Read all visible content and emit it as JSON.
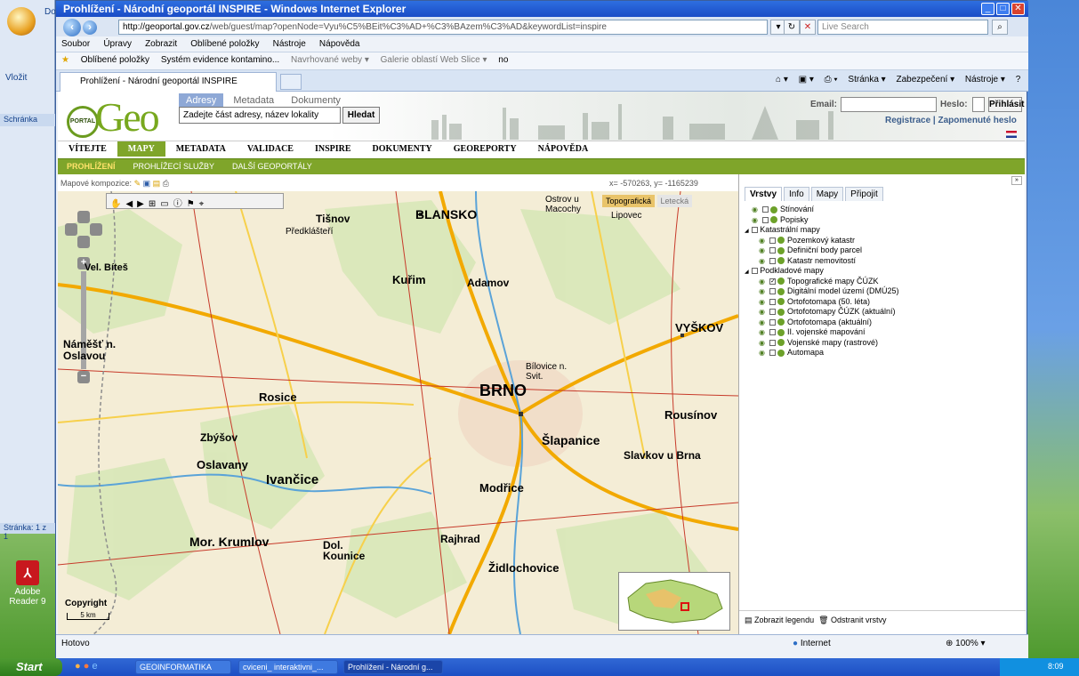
{
  "window": {
    "title": "Prohlížení - Národní geoportál INSPIRE - Windows Internet Explorer"
  },
  "word": {
    "tab": "Dom",
    "paste": "Vložit",
    "clipboard": "Schránka",
    "page": "Stránka: 1 z 1"
  },
  "desktop": {
    "icon_label": "Adobe Reader 9"
  },
  "browser": {
    "address_host": "http://geoportal.gov.cz",
    "address_path": "/web/guest/map?openNode=Vyu%C5%BEit%C3%AD+%C3%BAzem%C3%AD&keywordList=inspire",
    "live_search": "Live Search",
    "menu": [
      "Soubor",
      "Úpravy",
      "Zobrazit",
      "Oblíbené položky",
      "Nástroje",
      "Nápověda"
    ],
    "favorites": [
      {
        "label": "Oblíbené položky",
        "dim": false
      },
      {
        "label": "Systém evidence kontamino...",
        "dim": false
      },
      {
        "label": "Navrhované weby ▾",
        "dim": true
      },
      {
        "label": "Galerie oblastí Web Slice ▾",
        "dim": true
      },
      {
        "label": "no",
        "dim": false
      }
    ],
    "tab_title": "Prohlížení - Národní geoportál INSPIRE",
    "commands": [
      "Stránka ▾",
      "Zabezpečení ▾",
      "Nástroje ▾"
    ],
    "status": "Hotovo",
    "zone": "Internet",
    "zoom": "100%"
  },
  "page": {
    "logo_small": "PORTAL",
    "logo_big": "Geo",
    "search_tabs": [
      "Adresy",
      "Metadata",
      "Dokumenty"
    ],
    "search_placeholder": "Zadejte část adresy, název lokality",
    "search_button": "Hledat",
    "email_label": "Email:",
    "password_label": "Heslo:",
    "login_button": "Přihlásit",
    "register": "Registrace",
    "forgot": "Zapomenuté heslo",
    "nav": [
      "VÍTEJTE",
      "MAPY",
      "METADATA",
      "VALIDACE",
      "INSPIRE",
      "DOKUMENTY",
      "GEOREPORTY",
      "NÁPOVĚDA"
    ],
    "nav_active": "MAPY",
    "subnav": [
      "PROHLÍŽENÍ",
      "PROHLÍŽECÍ SLUŽBY",
      "DALŠÍ GEOPORTÁLY"
    ],
    "subnav_active": "PROHLÍŽENÍ",
    "compositions_label": "Mapové kompozice:",
    "coords": "x= -570263, y= -1165239"
  },
  "map": {
    "basemap_tabs": [
      "Topografická",
      "Letecká"
    ],
    "copyright": "Copyright",
    "scale": "5 km",
    "places": [
      {
        "t": "BLANSKO",
        "b": true
      },
      {
        "t": "BRNO",
        "b": true
      },
      {
        "t": "VYŠKOV",
        "b": true
      },
      {
        "t": "Tišnov",
        "b": false
      },
      {
        "t": "Kuřim",
        "b": false
      },
      {
        "t": "Rosice",
        "b": false
      },
      {
        "t": "Ivančice",
        "b": false
      },
      {
        "t": "Šlapanice",
        "b": false
      },
      {
        "t": "Slavkov u Brna",
        "b": false
      },
      {
        "t": "Židlochovice",
        "b": false
      },
      {
        "t": "Modřice",
        "b": false
      },
      {
        "t": "Rousínov",
        "b": false
      },
      {
        "t": "Mor. Krumlov",
        "b": false
      },
      {
        "t": "Náměšť n. Oslavou",
        "b": false
      },
      {
        "t": "Vel. Bíteš",
        "b": false
      },
      {
        "t": "Adamov",
        "b": false
      },
      {
        "t": "Oslavany",
        "b": false
      },
      {
        "t": "Zbýšov",
        "b": false
      },
      {
        "t": "Dol. Kounice",
        "b": false
      },
      {
        "t": "Rajhrad",
        "b": false
      },
      {
        "t": "Předklášteří",
        "b": false
      },
      {
        "t": "Lipovec",
        "b": false
      },
      {
        "t": "Bílovice n. Svit.",
        "b": false
      },
      {
        "t": "Ostrov u Macochy",
        "b": false
      }
    ]
  },
  "layers_panel": {
    "tabs": [
      "Vrstvy",
      "Info",
      "Mapy",
      "Připojit"
    ],
    "active_tab": "Vrstvy",
    "items": [
      {
        "label": "Stínování",
        "group": false,
        "indent": 1,
        "checked": false
      },
      {
        "label": "Popisky",
        "group": false,
        "indent": 1,
        "checked": false
      },
      {
        "label": "Katastrální mapy",
        "group": true,
        "indent": 0,
        "checked": false
      },
      {
        "label": "Pozemkový katastr",
        "group": false,
        "indent": 2,
        "checked": false
      },
      {
        "label": "Definiční body parcel",
        "group": false,
        "indent": 2,
        "checked": false
      },
      {
        "label": "Katastr nemovitostí",
        "group": false,
        "indent": 2,
        "checked": false
      },
      {
        "label": "Podkladové mapy",
        "group": true,
        "indent": 0,
        "checked": false
      },
      {
        "label": "Topografické mapy ČÚZK",
        "group": false,
        "indent": 2,
        "checked": true
      },
      {
        "label": "Digitální model území (DMÚ25)",
        "group": false,
        "indent": 2,
        "checked": false
      },
      {
        "label": "Ortofotomapa (50. léta)",
        "group": false,
        "indent": 2,
        "checked": false
      },
      {
        "label": "Ortofotomapy ČÚZK (aktuální)",
        "group": false,
        "indent": 2,
        "checked": false
      },
      {
        "label": "Ortofotomapa (aktuální)",
        "group": false,
        "indent": 2,
        "checked": false
      },
      {
        "label": "II. vojenské mapování",
        "group": false,
        "indent": 2,
        "checked": false
      },
      {
        "label": "Vojenské mapy (rastrové)",
        "group": false,
        "indent": 2,
        "checked": false
      },
      {
        "label": "Automapa",
        "group": false,
        "indent": 2,
        "checked": false
      }
    ],
    "show_legend": "Zobrazit legendu",
    "remove_layers": "Odstranit vrstvy"
  },
  "taskbar": {
    "start": "Start",
    "tasks": [
      {
        "label": "GEOINFORMATIKA",
        "active": false
      },
      {
        "label": "cviceni_ interaktivni_...",
        "active": false
      },
      {
        "label": "Prohlížení - Národní g...",
        "active": true
      }
    ],
    "clock": "8:09"
  }
}
